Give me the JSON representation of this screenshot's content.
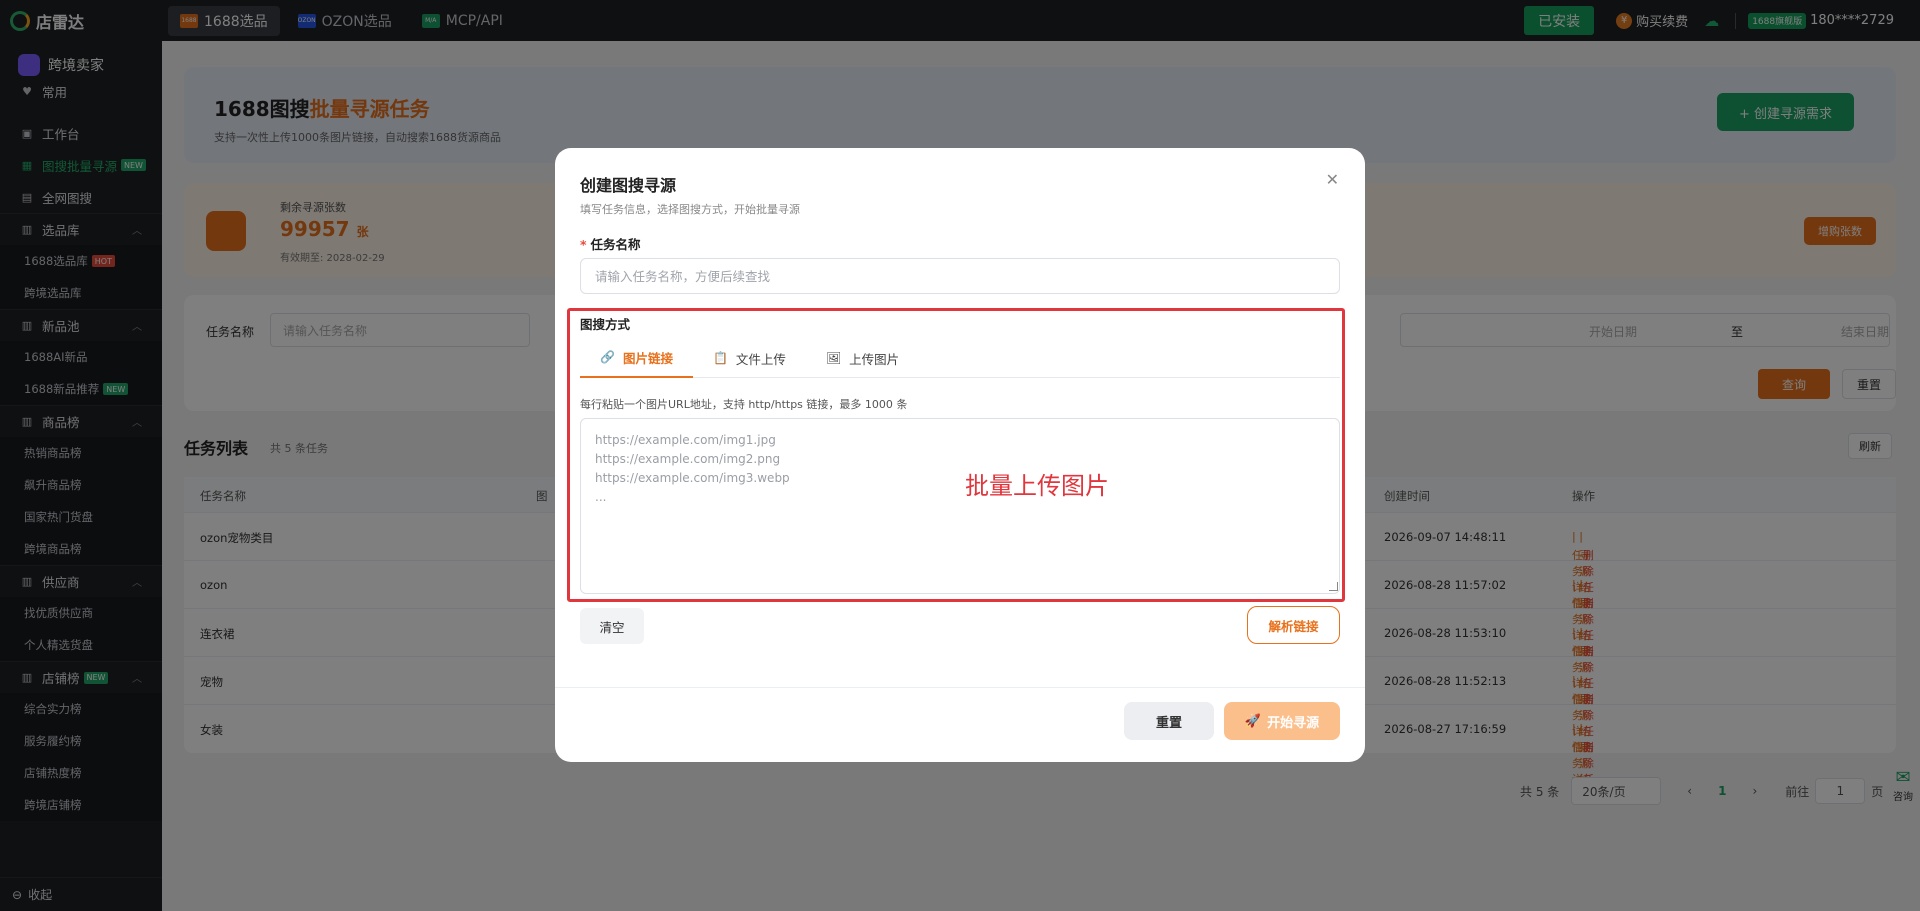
{
  "app": {
    "logo": "店雷达"
  },
  "top_tabs": [
    {
      "badge": "1688",
      "label": "1688选品",
      "color": "#e8711d"
    },
    {
      "badge": "OZON",
      "label": "OZON选品",
      "color": "#2456e6"
    },
    {
      "badge": "M/A",
      "label": "MCP/API",
      "color": "#1aa165"
    }
  ],
  "top_right": {
    "installed": "已安装",
    "buy": "购买续费",
    "vip": "1688旗舰版",
    "phone": "180****2729"
  },
  "sidebar": {
    "brand": "跨境卖家",
    "items": [
      {
        "icon": "♥",
        "label": "常用"
      },
      {
        "icon": "▣",
        "label": "工作台"
      },
      {
        "icon": "▦",
        "label": "图搜批量寻源",
        "tag": "NEW"
      },
      {
        "icon": "▤",
        "label": "全网图搜"
      }
    ],
    "groups": [
      {
        "icon": "▥",
        "label": "选品库",
        "subs": [
          {
            "label": "1688选品库",
            "tag": "HOT"
          },
          {
            "label": "跨境选品库"
          }
        ]
      },
      {
        "icon": "▥",
        "label": "新品池",
        "subs": [
          {
            "label": "1688AI新品"
          },
          {
            "label": "1688新品推荐",
            "tag": "NEW"
          }
        ]
      },
      {
        "icon": "▥",
        "label": "商品榜",
        "subs": [
          {
            "label": "热销商品榜"
          },
          {
            "label": "飙升商品榜"
          },
          {
            "label": "国家热门货盘"
          },
          {
            "label": "跨境商品榜"
          }
        ]
      },
      {
        "icon": "▥",
        "label": "供应商",
        "subs": [
          {
            "label": "找优质供应商"
          },
          {
            "label": "个人精选货盘"
          }
        ]
      },
      {
        "icon": "▥",
        "label": "店铺榜",
        "tag": "NEW",
        "subs": [
          {
            "label": "综合实力榜"
          },
          {
            "label": "服务履约榜"
          },
          {
            "label": "店铺热度榜"
          },
          {
            "label": "跨境店铺榜"
          }
        ]
      }
    ],
    "collapse": "收起"
  },
  "page": {
    "title_prefix": "1688图搜",
    "title_highlight": "批量寻源任务",
    "desc": "支持一次性上传1000条图片链接，自动搜索1688货源商品",
    "create_btn": "+ 创建寻源需求",
    "quota_label": "剩余寻源张数",
    "quota_value": "99957",
    "quota_unit": "张",
    "quota_expire": "有效期至: 2028-02-29",
    "buy_quota": "增购张数",
    "filter_name_label": "任务名称",
    "filter_name_placeholder": "请输入任务名称",
    "date_start": "开始日期",
    "date_to": "至",
    "date_end": "结束日期",
    "query": "查询",
    "reset": "重置",
    "list_title": "任务列表",
    "list_count": "共 5 条任务",
    "refresh": "刷新",
    "columns": {
      "name": "任务名称",
      "type": "图",
      "created": "创建时间",
      "ops": "操作"
    },
    "rows": [
      {
        "name": "ozon宠物类目",
        "created": "2026-09-07 14:48:11"
      },
      {
        "name": "ozon",
        "created": "2026-08-28 11:57:02"
      },
      {
        "name": "连衣裙",
        "created": "2026-08-28 11:53:10"
      },
      {
        "name": "宠物",
        "created": "2026-08-28 11:52:13"
      },
      {
        "name": "女装",
        "created": "2026-08-27 17:16:59"
      }
    ],
    "ops": {
      "detail": "任务详情",
      "result": "寻源结果",
      "delete": "删除任务"
    },
    "pager": {
      "total": "共 5 条",
      "size": "20条/页",
      "page": "1",
      "goto": "前往",
      "goto_val": "1",
      "unit": "页"
    },
    "consult": "咨询"
  },
  "modal": {
    "title": "创建图搜寻源",
    "subtitle": "填写任务信息，选择图搜方式，开始批量寻源",
    "name_label": "任务名称",
    "name_placeholder": "请输入任务名称，方便后续查找",
    "method_label": "图搜方式",
    "tabs": [
      {
        "icon": "🔗",
        "label": "图片链接"
      },
      {
        "icon": "📋",
        "label": "文件上传"
      },
      {
        "icon": "🖼",
        "label": "上传图片"
      }
    ],
    "hint": "每行粘贴一个图片URL地址，支持 http/https 链接，最多 1000 条",
    "urls_placeholder": "https://example.com/img1.jpg\nhttps://example.com/img2.png\nhttps://example.com/img3.webp\n...",
    "annotation": "批量上传图片",
    "clear": "清空",
    "parse": "解析链接",
    "reset": "重置",
    "start": "开始寻源"
  }
}
